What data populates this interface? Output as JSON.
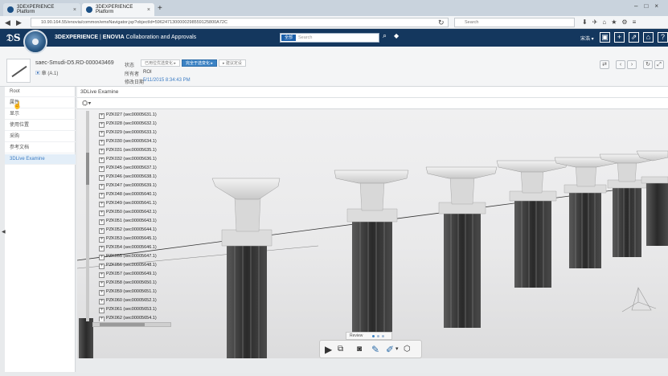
{
  "browser": {
    "tabs": [
      {
        "label": "3DEXPERIENCE Platform",
        "active": false
      },
      {
        "label": "3DEXPERIENCE Platform",
        "active": true
      }
    ],
    "new_tab": "+",
    "url": "10.90.164.55/enovia/common/emxNavigator.jsp?objectId=5962471300000298559125800A72C",
    "search_placeholder": "Search"
  },
  "app": {
    "brand": "3DEXPERIENCE",
    "separator": " | ",
    "product": "ENOVIA",
    "module": " Collaboration and Approvals",
    "search_scope": "全部",
    "search_placeholder": "Search",
    "user_name": "宋浩 ▾",
    "accent": "#14375e"
  },
  "object": {
    "name": "saec-Smudi-D5.RD-000043469",
    "revision": "章 (A.1)",
    "state_label": "状态",
    "states": [
      "已用位优选变化 ▸",
      "完全于选变化 ▸",
      "▸ 建议定设"
    ],
    "owner_label": "所有者",
    "owner_value": "ROI",
    "modified_label": "修改日期",
    "modified_value": "5/11/2015 8:34:43 PM"
  },
  "sidebar": {
    "root": "Root",
    "items": [
      "属性",
      "显示",
      "使用位置",
      "采购",
      "参考文档",
      "3DLive Examine"
    ],
    "active_index": 5
  },
  "viewer": {
    "title": "3DLive Examine",
    "tree": [
      "PZK027 (sec00005631.1)",
      "PZK028 (sec00005632.1)",
      "PZK029 (sec00005633.1)",
      "PZK030 (sec00005634.1)",
      "PZK031 (sec00005635.1)",
      "PZK032 (sec00005636.1)",
      "PZK045 (sec00005637.1)",
      "PZK046 (sec00005638.1)",
      "PZK047 (sec00005639.1)",
      "PZK048 (sec00005640.1)",
      "PZK049 (sec00005641.1)",
      "PZK050 (sec00005642.1)",
      "PZK051 (sec00005643.1)",
      "PZK052 (sec00005644.1)",
      "PZK053 (sec00005645.1)",
      "PZK054 (sec00005646.1)",
      "PZK055 (sec00005647.1)",
      "PZK056 (sec00005648.1)",
      "PZK057 (sec00005649.1)",
      "PZK058 (sec00005650.1)",
      "PZK059 (sec00005651.1)",
      "PZK060 (sec00005652.1)",
      "PZK061 (sec00005653.1)",
      "PZK062 (sec00005654.1)"
    ],
    "review_label": "Review"
  }
}
